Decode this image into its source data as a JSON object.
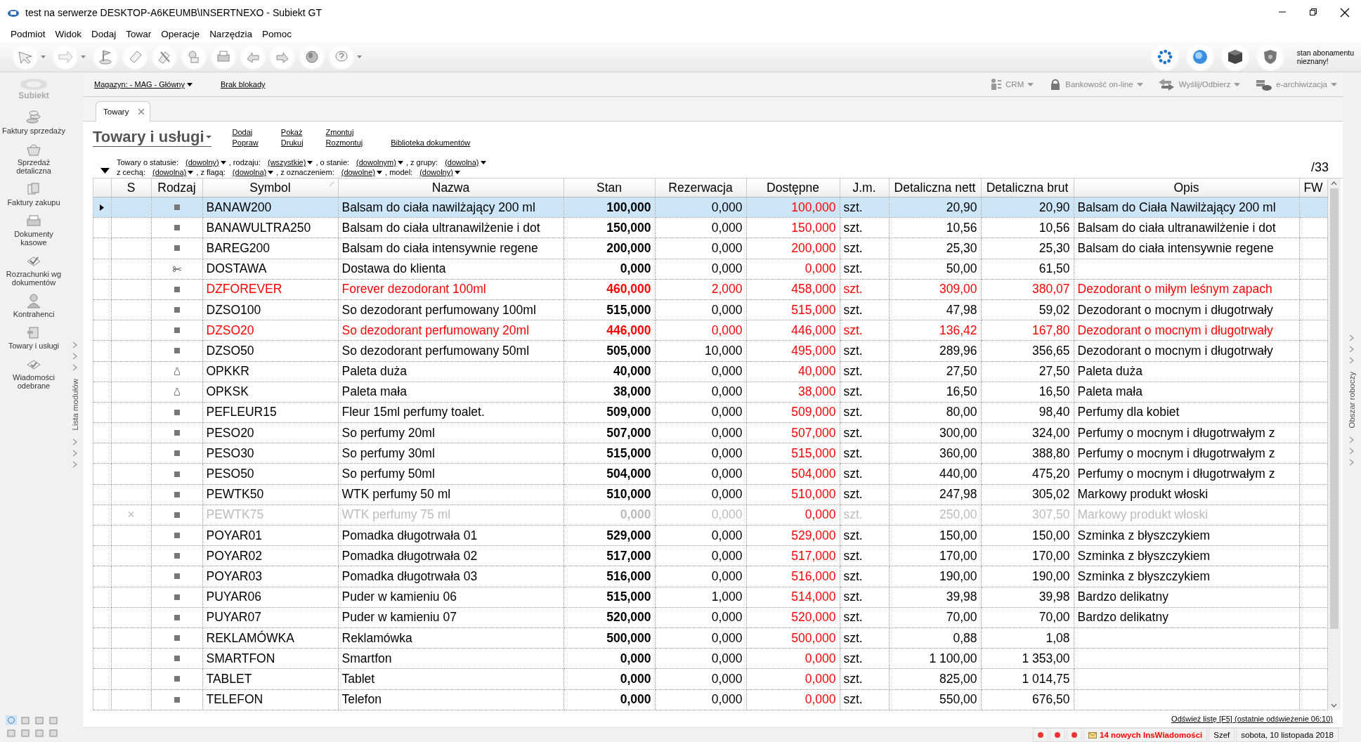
{
  "window": {
    "title": "test na serwerze DESKTOP-A6KEUMB\\INSERTNEXO - Subiekt GT"
  },
  "menu": [
    "Podmiot",
    "Widok",
    "Dodaj",
    "Towar",
    "Operacje",
    "Narzędzia",
    "Pomoc"
  ],
  "subscription": {
    "lines": [
      "stan abonamentu",
      "nieznany!"
    ]
  },
  "sidebar": {
    "logo": "Subiekt",
    "items": [
      "Faktury sprzedaży",
      "Sprzedaż detaliczna",
      "Faktury zakupu",
      "Dokumenty kasowe",
      "Rozrachunki wg dokumentów",
      "Kontrahenci",
      "Towary i usługi",
      "Wiadomości odebrane"
    ],
    "strip_label": "Lista modułów"
  },
  "right_strip": {
    "label": "Obszar roboczy"
  },
  "top_bar": {
    "links": [
      "Magazyn: - MAG - Główny",
      "Brak blokady"
    ],
    "tools": [
      "CRM",
      "Bankowość on-line",
      "Wyślij/Odbierz",
      "e-archiwizacja"
    ]
  },
  "tabs": [
    {
      "label": "Towary",
      "selected": true
    }
  ],
  "view": {
    "title": "Towary i usługi",
    "actions": [
      [
        "Dodaj",
        "Popraw"
      ],
      [
        "Pokaż",
        "Drukuj"
      ],
      [
        "Zmontuj",
        "Rozmontuj"
      ],
      [
        "Biblioteka dokumentów"
      ]
    ],
    "count": "/33"
  },
  "filters": [
    [
      {
        "label": "Towary o statusie:",
        "value": "(dowolny)"
      },
      {
        "label": ", rodzaju:",
        "value": "(wszystkie)"
      },
      {
        "label": ", o stanie:",
        "value": "(dowolnym)"
      },
      {
        "label": ", z grupy:",
        "value": "(dowolna)"
      }
    ],
    [
      {
        "label": "z cechą:",
        "value": "(dowolna)"
      },
      {
        "label": ", z flagą:",
        "value": "(dowolna)"
      },
      {
        "label": ", z oznaczeniem:",
        "value": "(dowolne)"
      },
      {
        "label": ", model:",
        "value": "(dowolny)"
      }
    ]
  ],
  "table": {
    "columns": [
      "S",
      "Rodzaj",
      "Symbol",
      "Nazwa",
      "Stan",
      "Rezerwacja",
      "Dostępne",
      "J.m.",
      "Detaliczna nett",
      "Detaliczna brut",
      "Opis",
      "FW"
    ],
    "rows": [
      {
        "selected": true,
        "alert": false,
        "inactive": false,
        "kind": "towar",
        "cells": [
          "",
          "",
          "BANAW200",
          "Balsam do ciała nawilżający 200 ml",
          "100,000",
          "0,000",
          "100,000",
          "szt.",
          "20,90",
          "20,90",
          "Balsam do Ciała Nawilżający 200 ml"
        ]
      },
      {
        "selected": false,
        "alert": false,
        "inactive": false,
        "kind": "towar",
        "cells": [
          "",
          "",
          "BANAWULTRA250",
          "Balsam do ciała ultranawilżenie i dot",
          "150,000",
          "0,000",
          "150,000",
          "szt.",
          "10,56",
          "10,56",
          "Balsam do ciała ultranawilżenie i dot"
        ]
      },
      {
        "selected": false,
        "alert": false,
        "inactive": false,
        "kind": "towar",
        "cells": [
          "",
          "",
          "BAREG200",
          "Balsam do ciała intensywnie regene",
          "200,000",
          "0,000",
          "200,000",
          "szt.",
          "25,30",
          "25,30",
          "Balsam do ciała intensywnie regene"
        ]
      },
      {
        "selected": false,
        "alert": false,
        "inactive": false,
        "kind": "usluga",
        "cells": [
          "",
          "",
          "DOSTAWA",
          "Dostawa do klienta",
          "0,000",
          "0,000",
          "0,000",
          "szt.",
          "50,00",
          "61,50"
        ]
      },
      {
        "selected": false,
        "alert": true,
        "inactive": false,
        "kind": "towar",
        "cells": [
          "",
          "",
          "DZFOREVER",
          "Forever dezodorant 100ml",
          "460,000",
          "2,000",
          "458,000",
          "szt.",
          "309,00",
          "380,07",
          "Dezodorant o miłym leśnym zapach"
        ]
      },
      {
        "selected": false,
        "alert": false,
        "inactive": false,
        "kind": "towar",
        "cells": [
          "",
          "",
          "DZSO100",
          "So dezodorant perfumowany 100ml",
          "515,000",
          "0,000",
          "515,000",
          "szt.",
          "47,98",
          "59,02",
          "Dezodorant o mocnym i długotrwały"
        ]
      },
      {
        "selected": false,
        "alert": true,
        "inactive": false,
        "kind": "towar",
        "cells": [
          "",
          "",
          "DZSO20",
          "So dezodorant perfumowany 20ml",
          "446,000",
          "0,000",
          "446,000",
          "szt.",
          "136,42",
          "167,80",
          "Dezodorant o mocnym i długotrwały"
        ]
      },
      {
        "selected": false,
        "alert": false,
        "inactive": false,
        "kind": "towar",
        "cells": [
          "",
          "",
          "DZSO50",
          "So dezodorant perfumowany 50ml",
          "505,000",
          "10,000",
          "495,000",
          "szt.",
          "289,96",
          "356,65",
          "Dezodorant o mocnym i długotrwały"
        ]
      },
      {
        "selected": false,
        "alert": false,
        "inactive": false,
        "kind": "opakowanie",
        "cells": [
          "",
          "",
          "OPKKR",
          "Paleta duża",
          "40,000",
          "0,000",
          "40,000",
          "szt.",
          "27,50",
          "27,50",
          "Paleta duża"
        ]
      },
      {
        "selected": false,
        "alert": false,
        "inactive": false,
        "kind": "opakowanie",
        "cells": [
          "",
          "",
          "OPKSK",
          "Paleta mała",
          "38,000",
          "0,000",
          "38,000",
          "szt.",
          "16,50",
          "16,50",
          "Paleta mała"
        ]
      },
      {
        "selected": false,
        "alert": false,
        "inactive": false,
        "kind": "towar",
        "cells": [
          "",
          "",
          "PEFLEUR15",
          "Fleur 15ml perfumy toalet.",
          "509,000",
          "0,000",
          "509,000",
          "szt.",
          "80,00",
          "98,40",
          "Perfumy dla kobiet"
        ]
      },
      {
        "selected": false,
        "alert": false,
        "inactive": false,
        "kind": "towar",
        "cells": [
          "",
          "",
          "PESO20",
          "So perfumy 20ml",
          "507,000",
          "0,000",
          "507,000",
          "szt.",
          "300,00",
          "324,00",
          "Perfumy o mocnym i długotrwałym z"
        ]
      },
      {
        "selected": false,
        "alert": false,
        "inactive": false,
        "kind": "towar",
        "cells": [
          "",
          "",
          "PESO30",
          "So perfumy 30ml",
          "515,000",
          "0,000",
          "515,000",
          "szt.",
          "360,00",
          "388,80",
          "Perfumy o mocnym i długotrwałym z"
        ]
      },
      {
        "selected": false,
        "alert": false,
        "inactive": false,
        "kind": "towar",
        "cells": [
          "",
          "",
          "PESO50",
          "So perfumy 50ml",
          "504,000",
          "0,000",
          "504,000",
          "szt.",
          "440,00",
          "475,20",
          "Perfumy o mocnym i długotrwałym z"
        ]
      },
      {
        "selected": false,
        "alert": false,
        "inactive": false,
        "kind": "towar",
        "cells": [
          "",
          "",
          "PEWTK50",
          "WTK perfumy 50 ml",
          "510,000",
          "0,000",
          "510,000",
          "szt.",
          "247,98",
          "305,02",
          "Markowy produkt włoski"
        ]
      },
      {
        "selected": false,
        "alert": false,
        "inactive": true,
        "kind": "towar",
        "cells": [
          "×",
          "",
          "PEWTK75",
          "WTK perfumy 75 ml",
          "0,000",
          "0,000",
          "0,000",
          "szt.",
          "250,00",
          "307,50",
          "Markowy produkt włoski"
        ]
      },
      {
        "selected": false,
        "alert": false,
        "inactive": false,
        "kind": "towar",
        "cells": [
          "",
          "",
          "POYAR01",
          "Pomadka długotrwała 01",
          "529,000",
          "0,000",
          "529,000",
          "szt.",
          "150,00",
          "150,00",
          "Szminka z błyszczykiem"
        ]
      },
      {
        "selected": false,
        "alert": false,
        "inactive": false,
        "kind": "towar",
        "cells": [
          "",
          "",
          "POYAR02",
          "Pomadka długotrwała 02",
          "517,000",
          "0,000",
          "517,000",
          "szt.",
          "170,00",
          "170,00",
          "Szminka z błyszczykiem"
        ]
      },
      {
        "selected": false,
        "alert": false,
        "inactive": false,
        "kind": "towar",
        "cells": [
          "",
          "",
          "POYAR03",
          "Pomadka długotrwała 03",
          "516,000",
          "0,000",
          "516,000",
          "szt.",
          "190,00",
          "190,00",
          "Szminka z błyszczykiem"
        ]
      },
      {
        "selected": false,
        "alert": false,
        "inactive": false,
        "kind": "towar",
        "cells": [
          "",
          "",
          "PUYAR06",
          "Puder w kamieniu 06",
          "515,000",
          "1,000",
          "514,000",
          "szt.",
          "39,98",
          "39,98",
          "Bardzo delikatny"
        ]
      },
      {
        "selected": false,
        "alert": false,
        "inactive": false,
        "kind": "towar",
        "cells": [
          "",
          "",
          "PUYAR07",
          "Puder w kamieniu 07",
          "520,000",
          "0,000",
          "520,000",
          "szt.",
          "70,00",
          "70,00",
          "Bardzo delikatny"
        ]
      },
      {
        "selected": false,
        "alert": false,
        "inactive": false,
        "kind": "towar",
        "cells": [
          "",
          "",
          "REKLAMÓWKA",
          "Reklamówka",
          "500,000",
          "0,000",
          "500,000",
          "szt.",
          "0,88",
          "1,08"
        ]
      },
      {
        "selected": false,
        "alert": false,
        "inactive": false,
        "kind": "towar",
        "cells": [
          "",
          "",
          "SMARTFON",
          "Smartfon",
          "0,000",
          "0,000",
          "0,000",
          "szt.",
          "1 100,00",
          "1 353,00"
        ]
      },
      {
        "selected": false,
        "alert": false,
        "inactive": false,
        "kind": "towar",
        "cells": [
          "",
          "",
          "TABLET",
          "Tablet",
          "0,000",
          "0,000",
          "0,000",
          "szt.",
          "825,00",
          "1 014,75"
        ]
      },
      {
        "selected": false,
        "alert": false,
        "inactive": false,
        "kind": "towar",
        "cells": [
          "",
          "",
          "TELEFON",
          "Telefon",
          "0,000",
          "0,000",
          "0,000",
          "szt.",
          "550,00",
          "676,50"
        ]
      }
    ]
  },
  "refresh": "Odśwież listę [F5] (ostatnie odświeżenie 06:10)",
  "status_bar": {
    "messages": "14 nowych InsWiadomości",
    "user": "Szef",
    "date": "sobota, 10 listopada 2018"
  }
}
